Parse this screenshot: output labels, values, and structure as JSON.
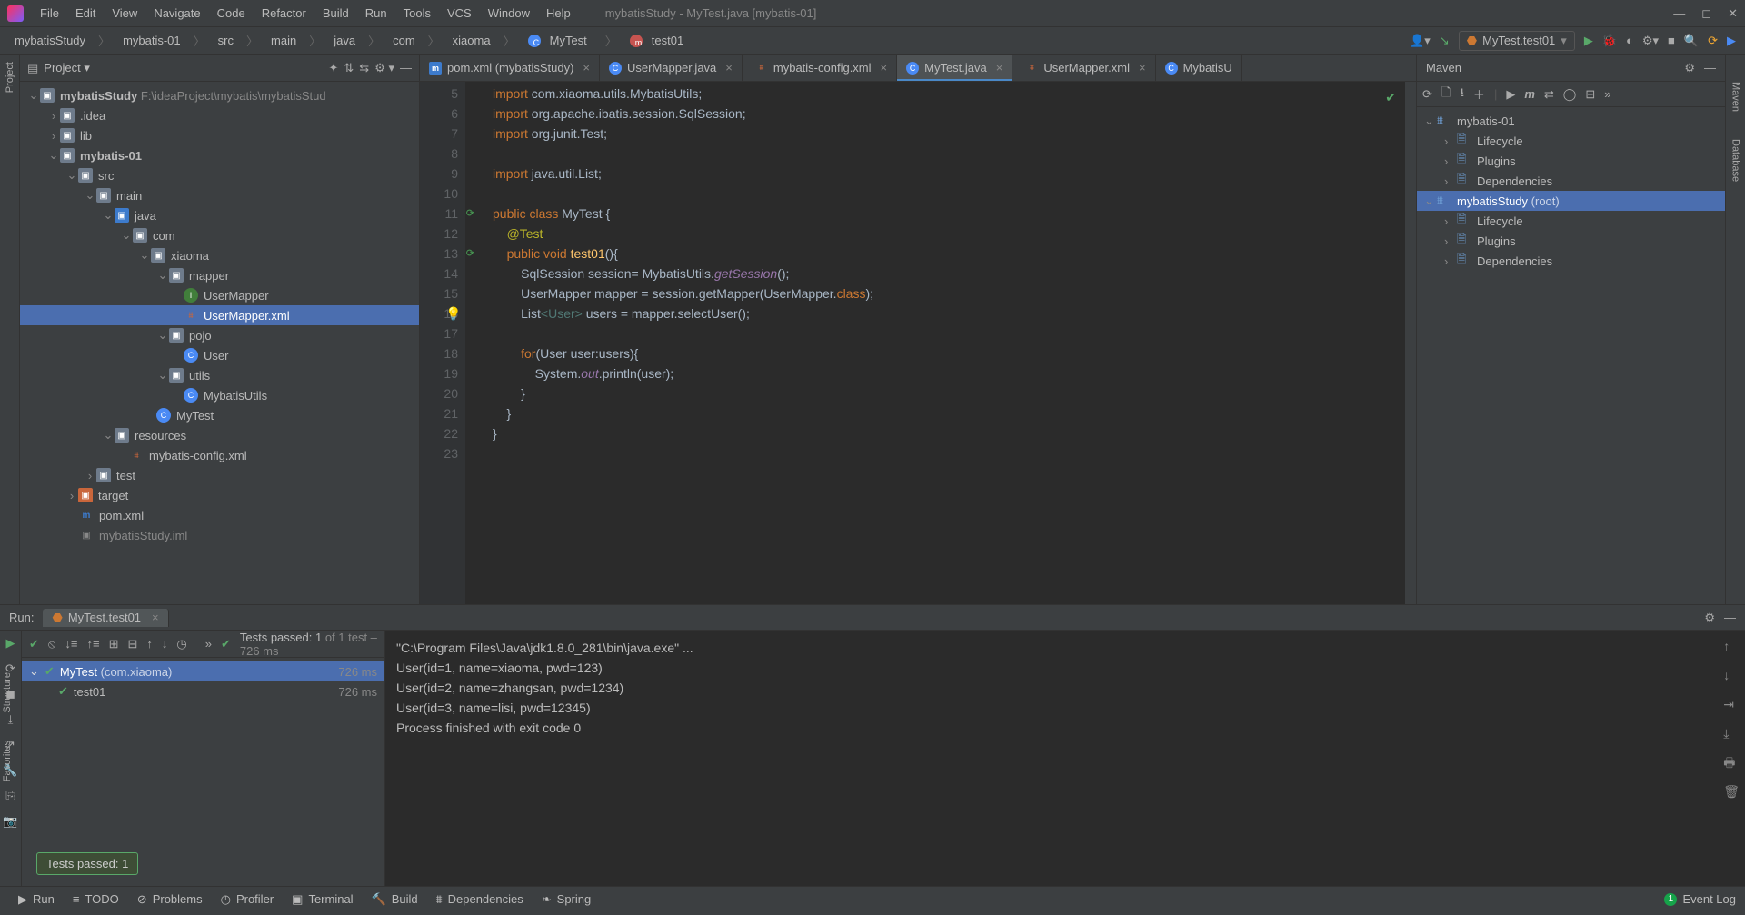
{
  "window_title": "mybatisStudy - MyTest.java [mybatis-01]",
  "menus": [
    "File",
    "Edit",
    "View",
    "Navigate",
    "Code",
    "Refactor",
    "Build",
    "Run",
    "Tools",
    "VCS",
    "Window",
    "Help"
  ],
  "breadcrumbs": [
    "mybatisStudy",
    "mybatis-01",
    "src",
    "main",
    "java",
    "com",
    "xiaoma",
    "MyTest",
    "test01"
  ],
  "run_config": "MyTest.test01",
  "project_panel": {
    "title": "Project",
    "root_name": "mybatisStudy",
    "root_path": "F:\\ideaProject\\mybatis\\mybatisStud",
    "nodes": {
      "idea": ".idea",
      "lib": "lib",
      "m01": "mybatis-01",
      "src": "src",
      "main": "main",
      "java": "java",
      "com": "com",
      "xiaoma": "xiaoma",
      "mapper": "mapper",
      "UserMapperJ": "UserMapper",
      "UserMapperX": "UserMapper.xml",
      "pojo": "pojo",
      "User": "User",
      "utils": "utils",
      "MybatisUtils": "MybatisUtils",
      "MyTest": "MyTest",
      "resources": "resources",
      "mbcfg": "mybatis-config.xml",
      "test": "test",
      "target": "target",
      "pom": "pom.xml",
      "iml": "mybatisStudy.iml"
    }
  },
  "tabs": [
    {
      "label": "pom.xml (mybatisStudy)",
      "type": "m"
    },
    {
      "label": "UserMapper.java",
      "type": "j"
    },
    {
      "label": "mybatis-config.xml",
      "type": "x"
    },
    {
      "label": "MyTest.java",
      "type": "j",
      "active": true
    },
    {
      "label": "UserMapper.xml",
      "type": "x"
    },
    {
      "label": "MybatisU",
      "type": "j",
      "trunc": true
    }
  ],
  "gutter_start": 5,
  "gutter_end": 23,
  "code": {
    "l5": "import com.xiaoma.utils.MybatisUtils;",
    "l6": "import org.apache.ibatis.session.SqlSession;",
    "l7": "import org.junit.Test;",
    "l9": "import java.util.List;",
    "l11a": "public class ",
    "l11b": "MyTest {",
    "l12": "@Test",
    "l13a": "public void ",
    "l13b": "test01",
    "l13c": "(){",
    "l14a": "SqlSession session= MybatisUtils.",
    "l14b": "getSession",
    "l14c": "();",
    "l15": "UserMapper mapper = session.getMapper(UserMapper.",
    "l15b": "class",
    "l15c": ");",
    "l16a": "List",
    "l16b": "<User>",
    "l16c": " users = mapper.selectUser();",
    "l18": "for(User user:users){",
    "l19a": "System.",
    "l19b": "out",
    "l19c": ".println(user);",
    "l20": "}",
    "l21": "}",
    "l22": "}"
  },
  "maven": {
    "title": "Maven",
    "nodes": {
      "m01": "mybatis-01",
      "lc": "Lifecycle",
      "pl": "Plugins",
      "dep": "Dependencies",
      "root": "mybatisStudy",
      "root_suffix": "(root)"
    }
  },
  "run": {
    "label": "Run:",
    "tab": "MyTest.test01",
    "status": "Tests passed: 1 of 1 test – 726 ms",
    "status_prefix": "Tests passed: 1",
    "status_rest": " of 1 test – 726 ms",
    "tree_root": "MyTest",
    "tree_root_pkg": "(com.xiaoma)",
    "tree_root_time": "726 ms",
    "tree_child": "test01",
    "tree_child_time": "726 ms",
    "console": [
      "\"C:\\Program Files\\Java\\jdk1.8.0_281\\bin\\java.exe\" ...",
      "User(id=1, name=xiaoma, pwd=123)",
      "User(id=2, name=zhangsan, pwd=1234)",
      "User(id=3, name=lisi, pwd=12345)",
      "",
      "Process finished with exit code 0"
    ],
    "tooltip": "Tests passed: 1"
  },
  "bottom": {
    "run": "Run",
    "todo": "TODO",
    "problems": "Problems",
    "profiler": "Profiler",
    "terminal": "Terminal",
    "build": "Build",
    "deps": "Dependencies",
    "spring": "Spring",
    "eventlog": "Event Log",
    "eventcount": "1"
  },
  "stripes": {
    "left_project": "Project",
    "left_structure": "Structure",
    "left_favorites": "Favorites",
    "right_maven": "Maven",
    "right_database": "Database"
  }
}
